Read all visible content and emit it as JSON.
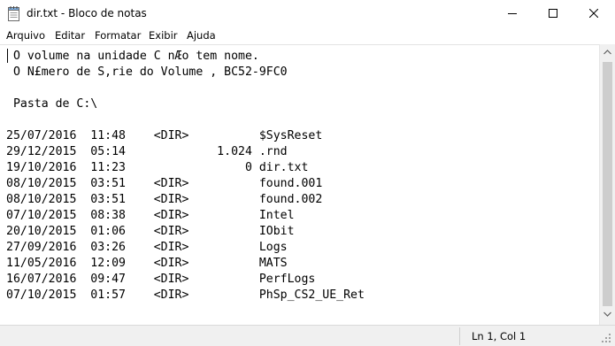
{
  "window": {
    "title": "dir.txt - Bloco de notas",
    "icon": "notepad-icon",
    "controls": [
      "minimize-icon",
      "maximize-icon",
      "close-icon"
    ]
  },
  "menu": {
    "items": [
      "Arquivo",
      "Editar",
      "Formatar",
      "Exibir",
      "Ajuda"
    ]
  },
  "document": {
    "lines": [
      " O volume na unidade C nÆo tem nome.",
      " O N£mero de S,rie do Volume , BC52-9FC0",
      "",
      " Pasta de C:\\",
      "",
      "25/07/2016  11:48    <DIR>          $SysReset",
      "29/12/2015  05:14             1.024 .rnd",
      "19/10/2016  11:23                 0 dir.txt",
      "08/10/2015  03:51    <DIR>          found.001",
      "08/10/2015  03:51    <DIR>          found.002",
      "07/10/2015  08:38    <DIR>          Intel",
      "20/10/2015  01:06    <DIR>          IObit",
      "27/09/2016  03:26    <DIR>          Logs",
      "11/05/2016  12:09    <DIR>          MATS",
      "16/07/2016  09:47    <DIR>          PerfLogs",
      "07/10/2015  01:57    <DIR>          PhSp_CS2_UE_Ret"
    ]
  },
  "status": {
    "position": "Ln 1, Col 1"
  }
}
